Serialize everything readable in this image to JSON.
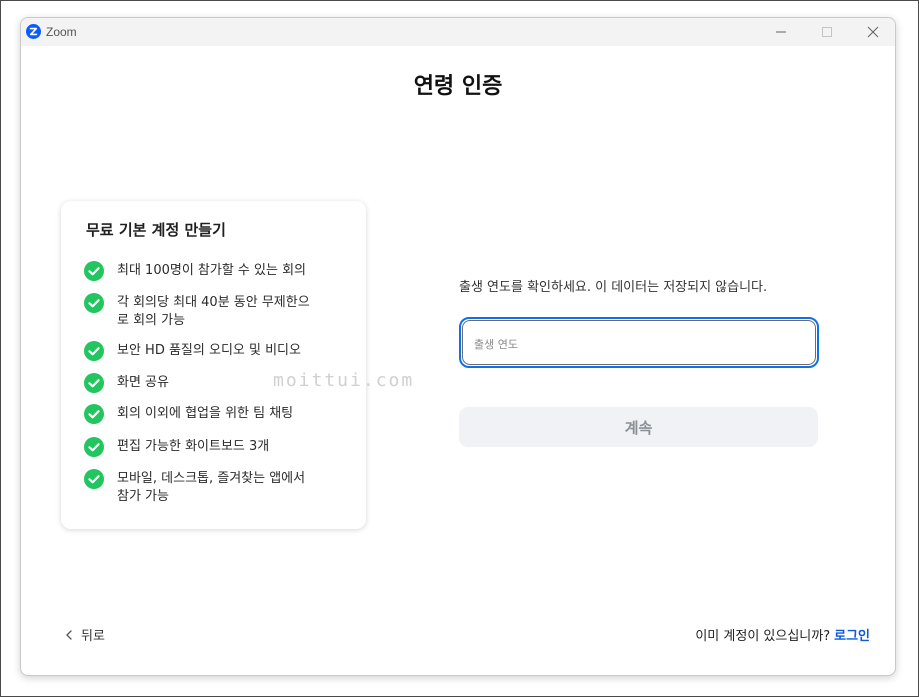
{
  "window": {
    "app_title": "Zoom"
  },
  "page": {
    "title": "연령 인증"
  },
  "card": {
    "title": "무료 기본 계정 만들기",
    "features": [
      "최대 100명이 참가할 수 있는 회의",
      "각 회의당 최대 40분 동안 무제한으\n로 회의 가능",
      "보안 HD 품질의 오디오 및 비디오",
      "화면 공유",
      "회의 이외에 협업을 위한 팀 채팅",
      "편집 가능한 화이트보드 3개",
      "모바일, 데스크톱, 즐겨찾는 앱에서\n참가 가능"
    ]
  },
  "form": {
    "prompt": "출생 연도를 확인하세요. 이 데이터는 저장되지 않습니다.",
    "birth_year_placeholder": "출생 연도",
    "birth_year_value": "",
    "continue_label": "계속"
  },
  "footer": {
    "back_label": "뒤로",
    "has_account_text": "이미 계정이 있으십니까?",
    "signin_label": "로그인"
  },
  "watermark": "moittui.com",
  "colors": {
    "accent": "#0e71eb",
    "check": "#22c55e",
    "link": "#0e5ad6",
    "button_disabled_bg": "#f0f2f5"
  }
}
